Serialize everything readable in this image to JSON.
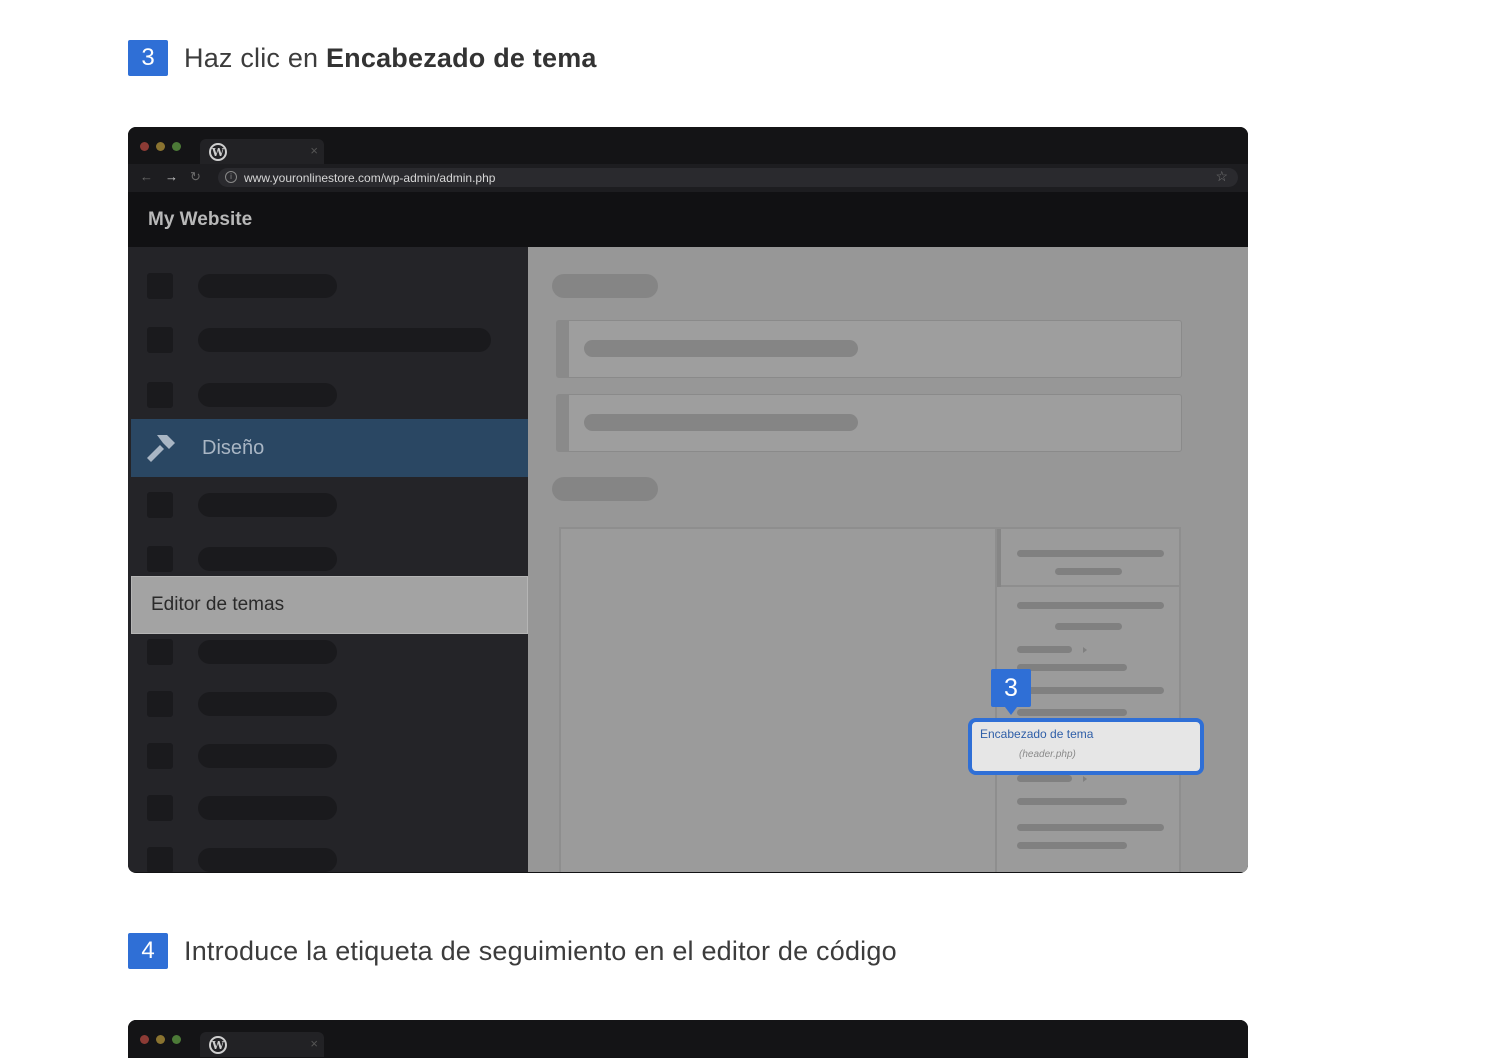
{
  "step3": {
    "number": "3",
    "prefix": "Haz clic en ",
    "bold": "Encabezado de tema"
  },
  "step4": {
    "number": "4",
    "text": "Introduce la etiqueta de seguimiento en el editor de código"
  },
  "browser": {
    "tab_icon": "wordpress-logo-icon",
    "tab_close": "×",
    "url": "www.youronlinestore.com/wp-admin/admin.php",
    "site_title": "My Website"
  },
  "sidebar": {
    "active_label": "Diseño",
    "submenu_label": "Editor de temas"
  },
  "callout": {
    "number": "3",
    "file_label": "Encabezado de tema",
    "file_name": "(header.php)"
  },
  "colors": {
    "accent": "#2f6fd6",
    "active_menu": "#2a4763"
  }
}
